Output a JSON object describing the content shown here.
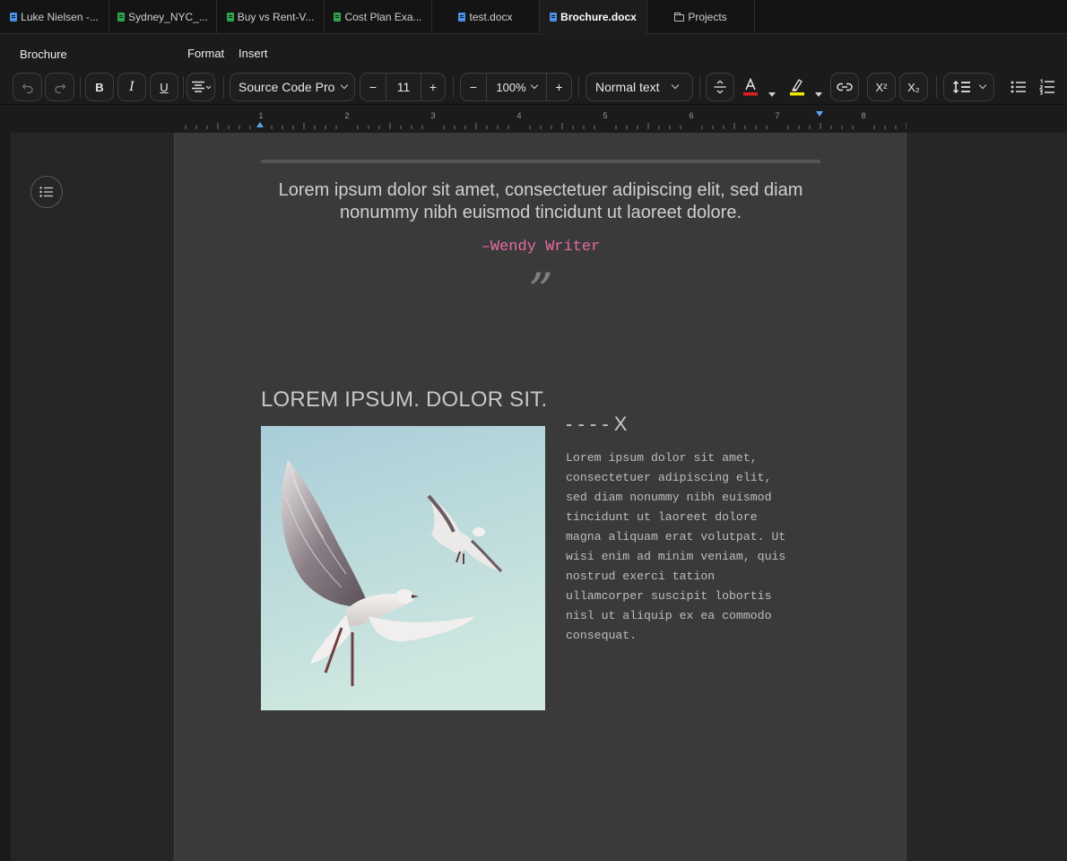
{
  "tabs": [
    {
      "label": "Luke Nielsen -...",
      "icon": "blue-doc-icon",
      "active": false
    },
    {
      "label": "Sydney_NYC_...",
      "icon": "green-sheet-icon",
      "active": false
    },
    {
      "label": "Buy vs Rent-V...",
      "icon": "green-sheet-icon",
      "active": false
    },
    {
      "label": "Cost Plan Exa...",
      "icon": "green-sheet-icon",
      "active": false
    },
    {
      "label": "test.docx",
      "icon": "blue-doc-icon",
      "active": false
    },
    {
      "label": "Brochure.docx",
      "icon": "blue-doc-icon",
      "active": true
    },
    {
      "label": "Projects",
      "icon": "folder-icon",
      "active": false
    }
  ],
  "menubar": {
    "doc_title": "Brochure",
    "menus": [
      "Format",
      "Insert"
    ]
  },
  "toolbar": {
    "undo": "undo-icon",
    "redo": "redo-icon",
    "bold": "B",
    "italic": "I",
    "underline": "U",
    "font_family": "Source Code Pro",
    "font_size": "11",
    "minus": "−",
    "plus": "+",
    "zoom": "100%",
    "style": "Normal text",
    "superscript": "X²",
    "subscript": "X₂",
    "text_color": "#e02020",
    "highlight_color": "#f2e600"
  },
  "ruler": {
    "numbers": [
      "1",
      "2",
      "3",
      "4",
      "5",
      "6",
      "7",
      "8"
    ]
  },
  "document": {
    "quote": "Lorem ipsum dolor sit amet, consectetuer adipiscing elit, sed diam nonummy nibh euismod tincidunt ut laoreet dolore.",
    "attribution": "–Wendy Writer",
    "quote_mark": "”",
    "heading": "LOREM IPSUM. DOLOR SIT.",
    "subheading": "- - - - X",
    "body": "Lorem ipsum dolor sit amet,\nconsectetuer adipiscing elit,\nsed diam nonummy nibh euismod\ntincidunt ut laoreet dolore\nmagna aliquam erat volutpat. Ut\nwisi enim ad minim veniam, quis\nnostrud exerci tation\nullamcorper suscipit lobortis\nnisl ut aliquip ex ea commodo\nconsequat."
  },
  "colors": {
    "accent_pink": "#e86aa6",
    "page_bg": "#3a3a3a",
    "sky_top": "#a9cdd8",
    "sky_bottom": "#cfe8e0"
  }
}
